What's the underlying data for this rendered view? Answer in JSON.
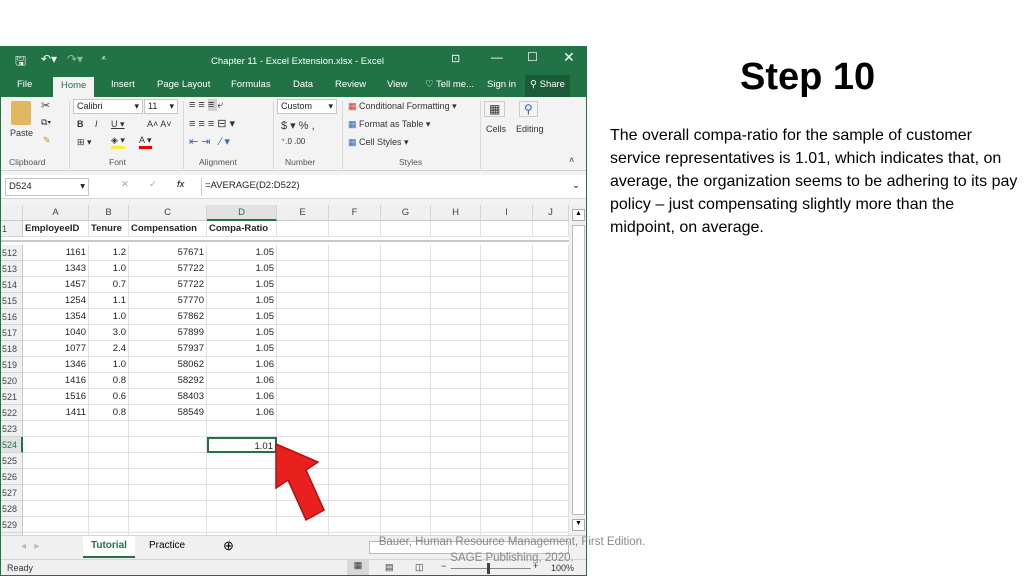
{
  "window": {
    "title": "Chapter 11 - Excel Extension.xlsx - Excel"
  },
  "ribbon_tabs": [
    "File",
    "Home",
    "Insert",
    "Page Layout",
    "Formulas",
    "Data",
    "Review",
    "View",
    "Tell me...",
    "Sign in",
    "Share"
  ],
  "ribbon": {
    "paste": "Paste",
    "font_name": "Calibri",
    "font_size": "11",
    "number_format": "Custom",
    "conditional_formatting": "Conditional Formatting",
    "format_as_table": "Format as Table",
    "cell_styles": "Cell Styles",
    "cells": "Cells",
    "editing": "Editing",
    "groups": [
      "Clipboard",
      "Font",
      "Alignment",
      "Number",
      "Styles"
    ]
  },
  "formula_bar": {
    "name_box": "D524",
    "formula": "=AVERAGE(D2:D522)"
  },
  "columns": [
    "A",
    "B",
    "C",
    "D",
    "E",
    "F",
    "G",
    "H",
    "I",
    "J"
  ],
  "header_row": {
    "row": "1",
    "cells": [
      "EmployeeID",
      "Tenure",
      "Compensation",
      "Compa-Ratio"
    ]
  },
  "rows": [
    {
      "row": "512",
      "cells": [
        "1161",
        "1.2",
        "57671",
        "1.05"
      ]
    },
    {
      "row": "513",
      "cells": [
        "1343",
        "1.0",
        "57722",
        "1.05"
      ]
    },
    {
      "row": "514",
      "cells": [
        "1457",
        "0.7",
        "57722",
        "1.05"
      ]
    },
    {
      "row": "515",
      "cells": [
        "1254",
        "1.1",
        "57770",
        "1.05"
      ]
    },
    {
      "row": "516",
      "cells": [
        "1354",
        "1.0",
        "57862",
        "1.05"
      ]
    },
    {
      "row": "517",
      "cells": [
        "1040",
        "3.0",
        "57899",
        "1.05"
      ]
    },
    {
      "row": "518",
      "cells": [
        "1077",
        "2.4",
        "57937",
        "1.05"
      ]
    },
    {
      "row": "519",
      "cells": [
        "1346",
        "1.0",
        "58062",
        "1.06"
      ]
    },
    {
      "row": "520",
      "cells": [
        "1416",
        "0.8",
        "58292",
        "1.06"
      ]
    },
    {
      "row": "521",
      "cells": [
        "1516",
        "0.6",
        "58403",
        "1.06"
      ]
    },
    {
      "row": "522",
      "cells": [
        "1411",
        "0.8",
        "58549",
        "1.06"
      ]
    },
    {
      "row": "523",
      "cells": [
        "",
        "",
        "",
        ""
      ]
    },
    {
      "row": "524",
      "cells": [
        "",
        "",
        "",
        "1.01"
      ]
    },
    {
      "row": "525",
      "cells": [
        "",
        "",
        "",
        ""
      ]
    },
    {
      "row": "526",
      "cells": [
        "",
        "",
        "",
        ""
      ]
    },
    {
      "row": "527",
      "cells": [
        "",
        "",
        "",
        ""
      ]
    },
    {
      "row": "528",
      "cells": [
        "",
        "",
        "",
        ""
      ]
    },
    {
      "row": "529",
      "cells": [
        "",
        "",
        "",
        ""
      ]
    },
    {
      "row": "530",
      "cells": [
        "",
        "",
        "",
        ""
      ]
    }
  ],
  "selected_cell": "D524",
  "sheets": [
    "Tutorial",
    "Practice"
  ],
  "active_sheet": "Tutorial",
  "status": {
    "text": "Ready",
    "zoom": "100%"
  },
  "slide": {
    "title": "Step 10",
    "body": "The overall compa-ratio for the sample of customer service representatives is 1.01, which indicates that, on average, the organization seems to be adhering to its pay policy – just compensating slightly more than the midpoint, on average.",
    "credit": "Bauer, Human Resource Management, First Edition. SAGE Publishing, 2020."
  },
  "colors": {
    "excel_green": "#217346",
    "arrow_red": "#e8211f"
  }
}
